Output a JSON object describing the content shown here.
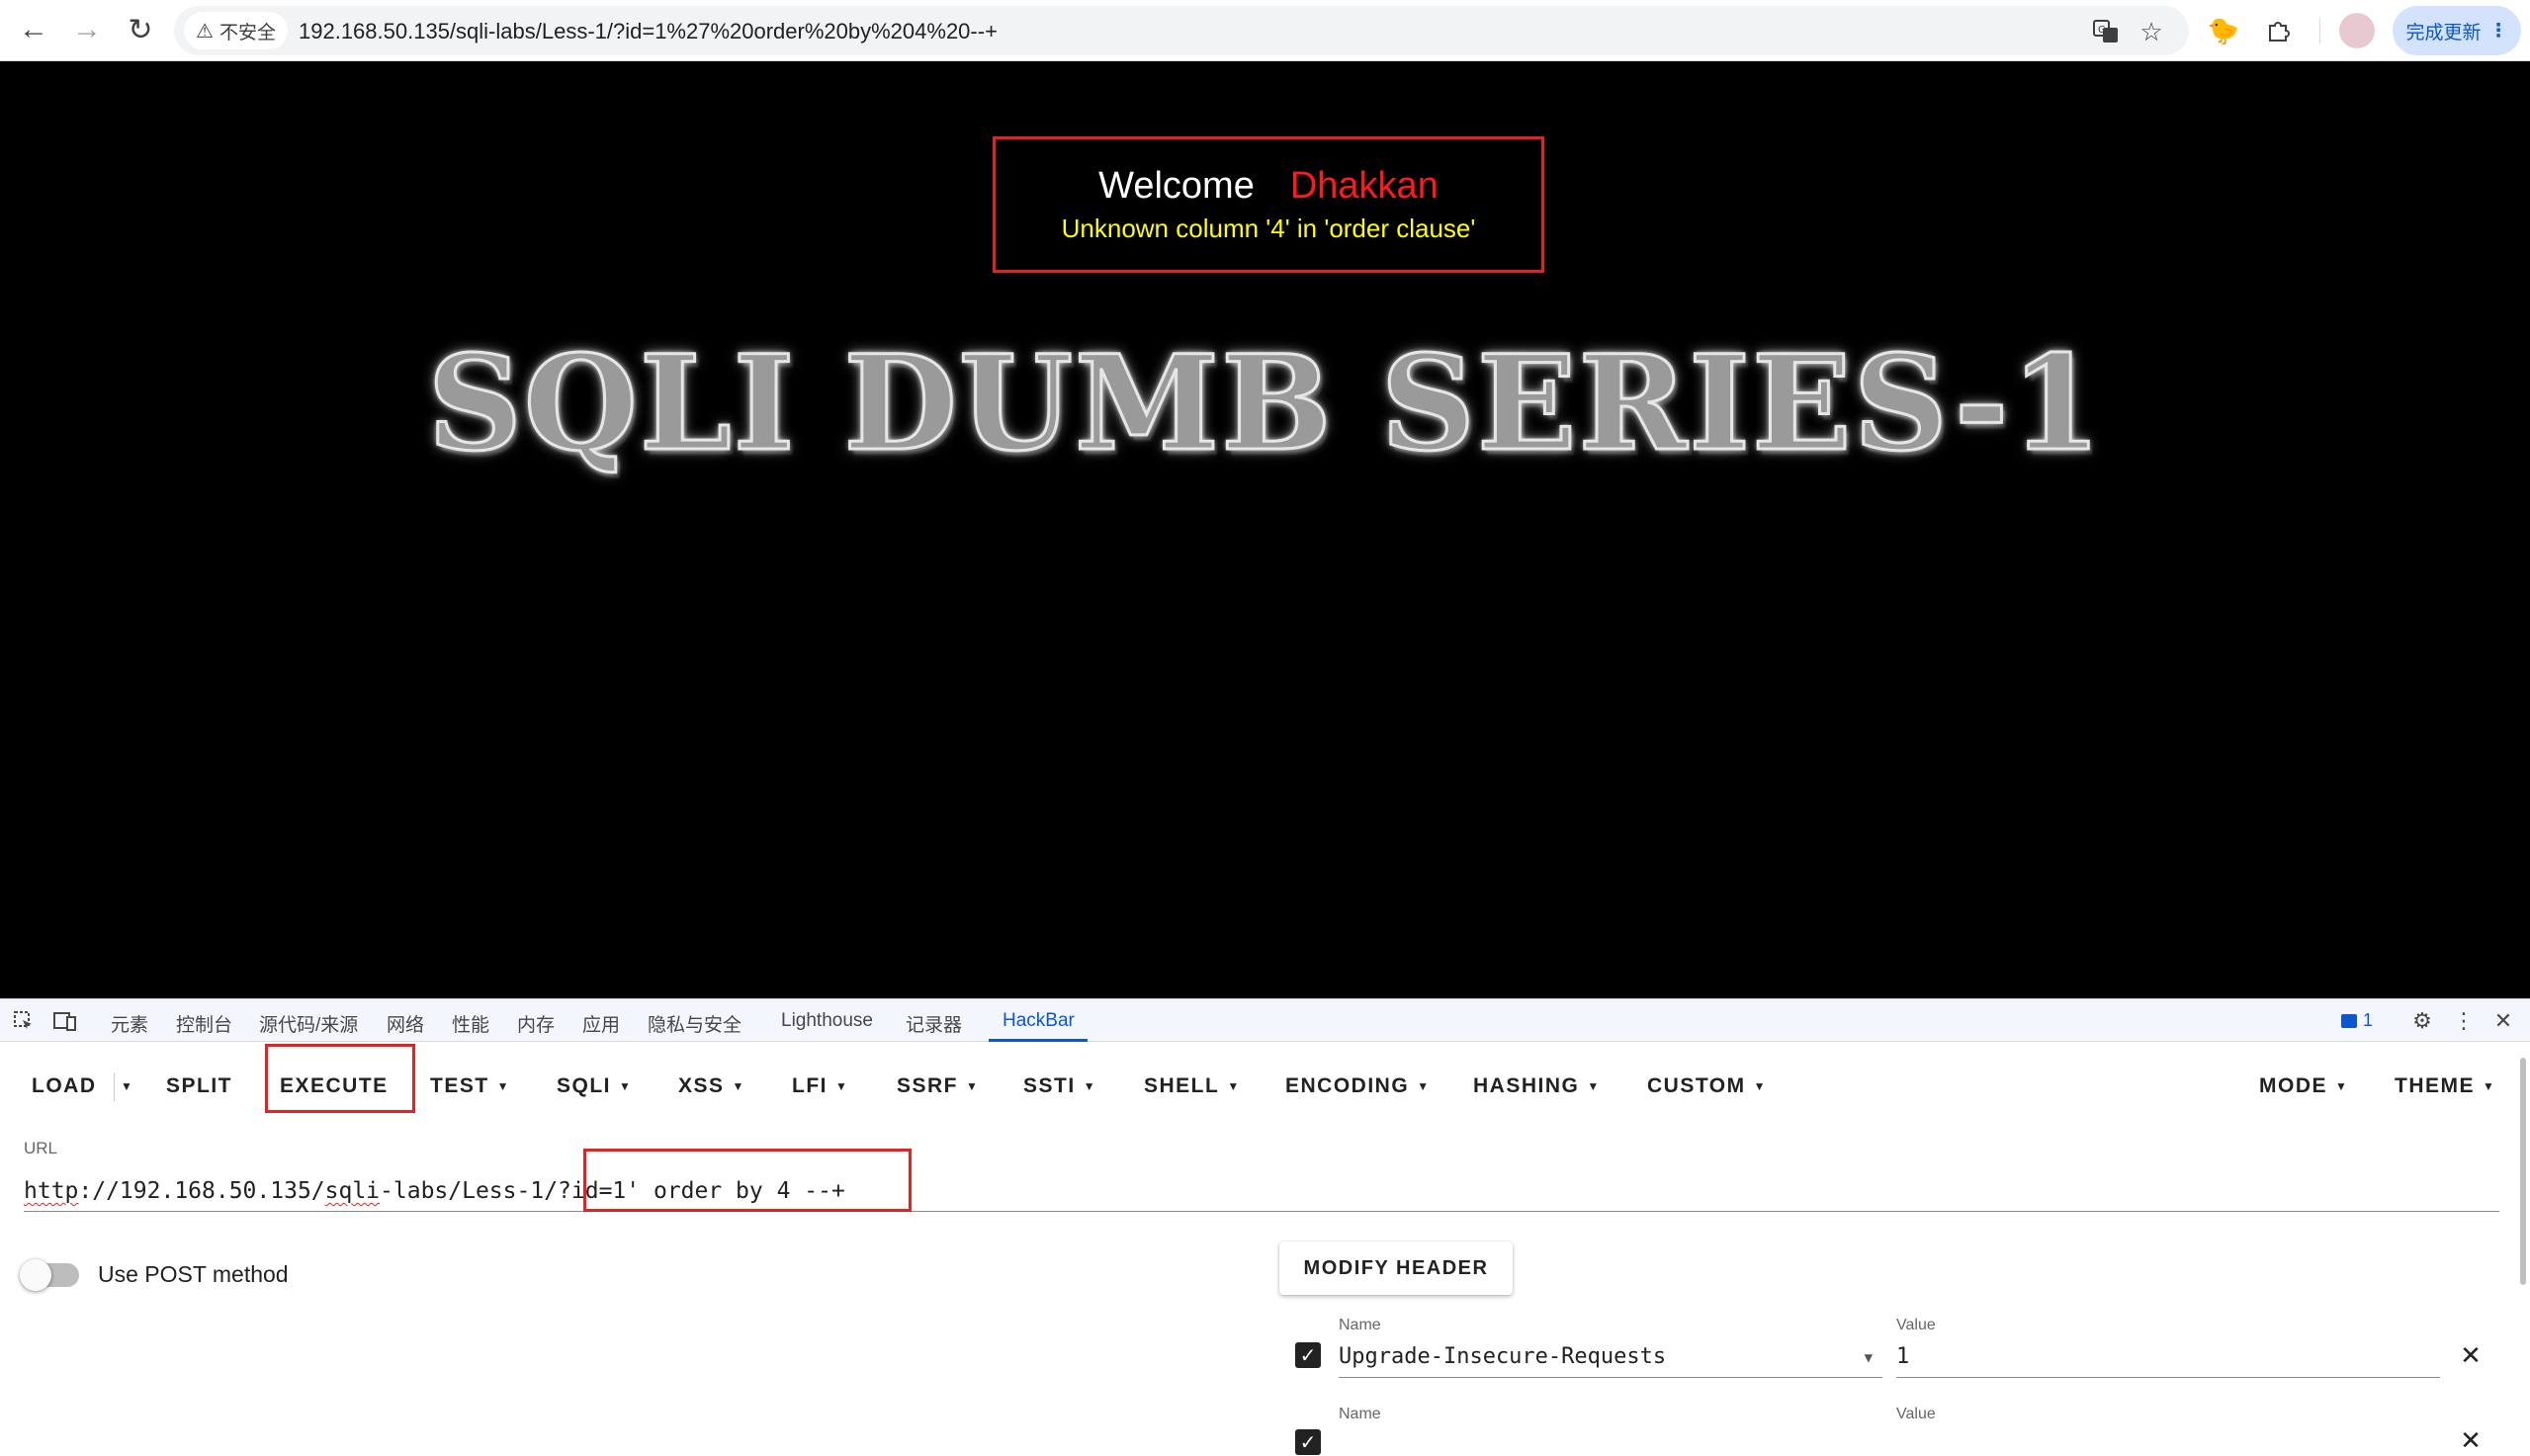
{
  "browser": {
    "security_label": "不安全",
    "url": "192.168.50.135/sqli-labs/Less-1/?id=1%27%20order%20by%204%20--+",
    "update_label": "完成更新"
  },
  "page": {
    "welcome": "Welcome",
    "user_name": "Dhakkan",
    "error_message": "Unknown column '4' in 'order clause'",
    "banner": "SQLI DUMB SERIES-1"
  },
  "devtools": {
    "tabs": [
      "元素",
      "控制台",
      "源代码/来源",
      "网络",
      "性能",
      "内存",
      "应用",
      "隐私与安全",
      "Lighthouse",
      "记录器",
      "HackBar"
    ],
    "active_tab": "HackBar",
    "issues_count": "1"
  },
  "hackbar": {
    "buttons": {
      "load": "LOAD",
      "split": "SPLIT",
      "execute": "EXECUTE",
      "test": "TEST",
      "sqli": "SQLI",
      "xss": "XSS",
      "lfi": "LFI",
      "ssrf": "SSRF",
      "ssti": "SSTI",
      "shell": "SHELL",
      "encoding": "ENCODING",
      "hashing": "HASHING",
      "custom": "CUSTOM",
      "mode": "MODE",
      "theme": "THEME"
    },
    "url_label": "URL",
    "url_parts": {
      "scheme": "http",
      "middle": "://192.168.50.135/",
      "sqli": "sqli",
      "rest": "-labs/Less-1/",
      "query": "?id=1' order by 4 --+"
    },
    "post_label": "Use POST method",
    "post_enabled": false,
    "modify_header_label": "MODIFY HEADER",
    "header_name_label": "Name",
    "header_value_label": "Value",
    "headers": [
      {
        "enabled": true,
        "name": "Upgrade-Insecure-Requests",
        "value": "1"
      },
      {
        "enabled": true,
        "name": "",
        "value": ""
      }
    ]
  }
}
